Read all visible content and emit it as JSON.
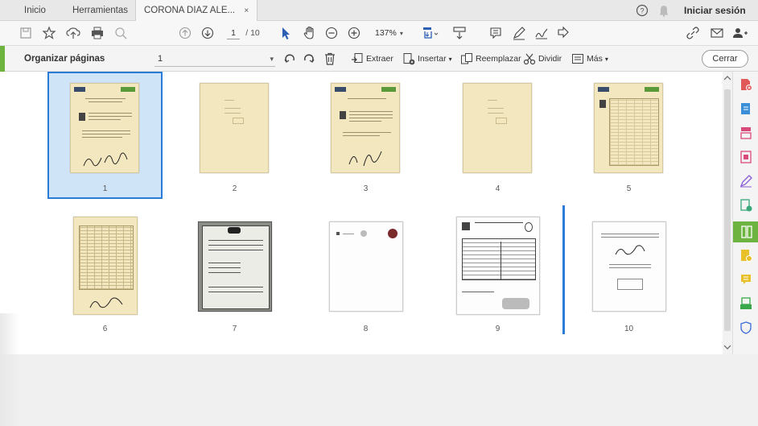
{
  "tabs": {
    "home": "Inicio",
    "tools": "Herramientas",
    "document": "CORONA DIAZ ALE...",
    "close_symbol": "×"
  },
  "account": {
    "help_symbol": "?",
    "signin": "Iniciar sesión"
  },
  "toolbar": {
    "current_page": "1",
    "total_pages": "/ 10",
    "zoom": "137%"
  },
  "organize": {
    "title": "Organizar páginas",
    "page_range": "1",
    "extract": "Extraer",
    "insert": "Insertar",
    "replace": "Reemplazar",
    "split": "Dividir",
    "more": "Más",
    "close": "Cerrar",
    "caret": "▾"
  },
  "pages": [
    {
      "num": "1",
      "selected": true
    },
    {
      "num": "2"
    },
    {
      "num": "3"
    },
    {
      "num": "4"
    },
    {
      "num": "5"
    },
    {
      "num": "6"
    },
    {
      "num": "7"
    },
    {
      "num": "8"
    },
    {
      "num": "9"
    },
    {
      "num": "10"
    }
  ],
  "colors": {
    "accent_green": "#6db33f",
    "selection_blue": "#2b7bd8"
  },
  "icons": [
    "save-icon",
    "star-icon",
    "upload-icon",
    "print-icon",
    "zoom-search-icon",
    "page-up-icon",
    "page-down-icon",
    "select-arrow-icon",
    "hand-icon",
    "zoom-out-icon",
    "zoom-in-icon",
    "fit-page-icon",
    "scroll-icon",
    "comment-icon",
    "pen-icon",
    "sign-icon",
    "share-icon",
    "link-icon",
    "mail-icon",
    "add-user-icon",
    "rotate-left-icon",
    "rotate-right-icon",
    "trash-icon"
  ]
}
